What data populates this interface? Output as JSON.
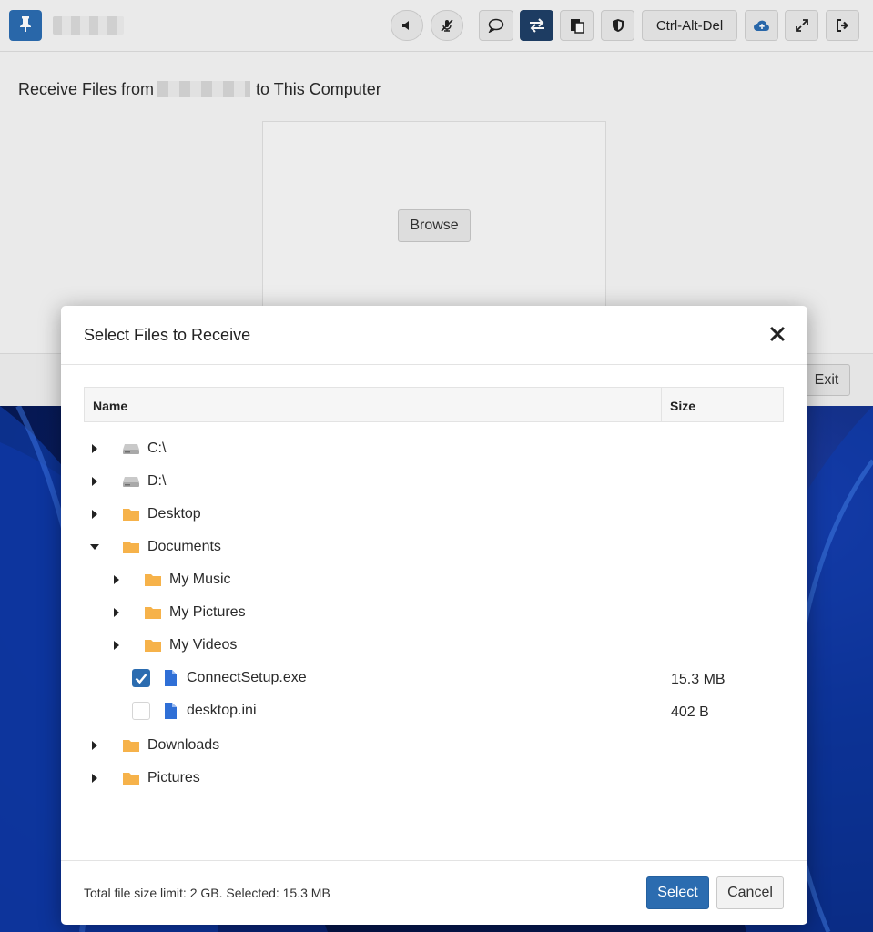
{
  "toolbar": {
    "ctrl_alt_del_label": "Ctrl-Alt-Del"
  },
  "panel": {
    "title_prefix": "Receive Files from",
    "title_suffix": "to This Computer",
    "browse_label": "Browse",
    "exit_label": "Exit"
  },
  "dialog": {
    "title": "Select Files to Receive",
    "columns": {
      "name": "Name",
      "size": "Size"
    },
    "tree": [
      {
        "name": "C:\\",
        "type": "drive",
        "expanded": false,
        "size": ""
      },
      {
        "name": "D:\\",
        "type": "drive",
        "expanded": false,
        "size": ""
      },
      {
        "name": "Desktop",
        "type": "folder",
        "expanded": false,
        "size": ""
      },
      {
        "name": "Documents",
        "type": "folder",
        "expanded": true,
        "size": ""
      },
      {
        "name": "My Music",
        "type": "folder",
        "expanded": false,
        "size": ""
      },
      {
        "name": "My Pictures",
        "type": "folder",
        "expanded": false,
        "size": ""
      },
      {
        "name": "My Videos",
        "type": "folder",
        "expanded": false,
        "size": ""
      },
      {
        "name": "ConnectSetup.exe",
        "type": "file",
        "checked": true,
        "size": "15.3 MB"
      },
      {
        "name": "desktop.ini",
        "type": "file",
        "checked": false,
        "size": "402 B"
      },
      {
        "name": "Downloads",
        "type": "folder",
        "expanded": false,
        "size": ""
      },
      {
        "name": "Pictures",
        "type": "folder",
        "expanded": false,
        "size": ""
      }
    ],
    "footer_text": "Total file size limit: 2 GB. Selected: 15.3 MB",
    "select_label": "Select",
    "cancel_label": "Cancel"
  },
  "colors": {
    "accent": "#2b6cb0",
    "folder": "#f6b24a",
    "file": "#2f6fd6",
    "active_toolbar": "#1f3f66"
  }
}
